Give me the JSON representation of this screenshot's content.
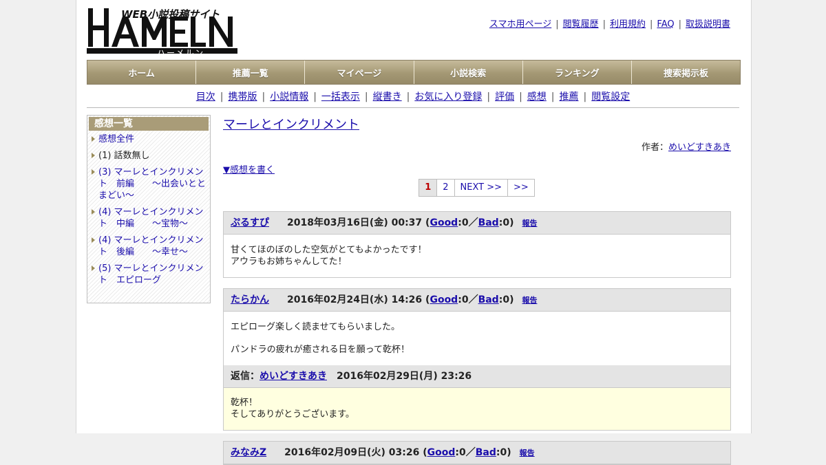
{
  "header": {
    "logo": {
      "main": "HAMELN",
      "tagline": "WEB小説投稿サイト",
      "kana": "ハーメルン"
    },
    "top_links": [
      "スマホ用ページ",
      "閲覧履歴",
      "利用規約",
      "FAQ",
      "取扱説明書"
    ]
  },
  "main_nav": [
    "ホーム",
    "推薦一覧",
    "マイページ",
    "小説検索",
    "ランキング",
    "捜索掲示板"
  ],
  "sub_nav": [
    "目次",
    "携帯版",
    "小説情報",
    "一括表示",
    "縦書き",
    "お気に入り登録",
    "評価",
    "感想",
    "推薦",
    "閲覧設定"
  ],
  "sidebar": {
    "title": "感想一覧",
    "items": [
      {
        "label": "感想全件",
        "link": true
      },
      {
        "label": "(1) 話数無し",
        "link": false
      },
      {
        "label": "(3) マーレとインクリメント　前編　　～出会いととまどい～",
        "link": true
      },
      {
        "label": "(4) マーレとインクリメント　中編　　～宝物～",
        "link": true
      },
      {
        "label": "(4) マーレとインクリメント　後編　　～幸せ～",
        "link": true
      },
      {
        "label": "(5) マーレとインクリメント　エピローグ",
        "link": true
      }
    ]
  },
  "content": {
    "novel_title": "マーレとインクリメント",
    "author_label": "作者：",
    "author_name": "めいどすきあき",
    "write_link": "▼感想を書く",
    "pager": [
      "1",
      "2",
      "NEXT >>",
      ">>"
    ],
    "current_page": "1",
    "comments": [
      {
        "user": "ぷるすぴ",
        "date": "2018年03月16日(金) 00:37",
        "good_label": "Good",
        "good": "0",
        "bad_label": "Bad",
        "bad": "0",
        "report": "報告",
        "lines": [
          "甘くてほのぼのした空気がとてもよかったです！",
          "アウラもお姉ちゃんしてた！"
        ]
      },
      {
        "user": "たらかん",
        "date": "2016年02月24日(水) 14:26",
        "good_label": "Good",
        "good": "0",
        "bad_label": "Bad",
        "bad": "0",
        "report": "報告",
        "paragraphs": [
          "エピローグ楽しく読ませてもらいました。",
          "パンドラの疲れが癒される日を願って乾杯！"
        ],
        "reply": {
          "label": "返信：",
          "user": "めいどすきあき",
          "date": "2016年02月29日(月) 23:26",
          "lines": [
            "乾杯！",
            "そしてありがとうございます。"
          ]
        }
      },
      {
        "user": "みなみZ",
        "date": "2016年02月09日(火) 03:26",
        "good_label": "Good",
        "good": "0",
        "bad_label": "Bad",
        "bad": "0",
        "report": "報告"
      }
    ]
  },
  "colors": {
    "nav_gradient_top": "#c6bb9b",
    "nav_gradient_bottom": "#968a68",
    "sidebar_header": "#a99c78",
    "link": "#1a0dab",
    "reply_background": "#ffffe0",
    "comment_header": "#e4e4e4"
  }
}
